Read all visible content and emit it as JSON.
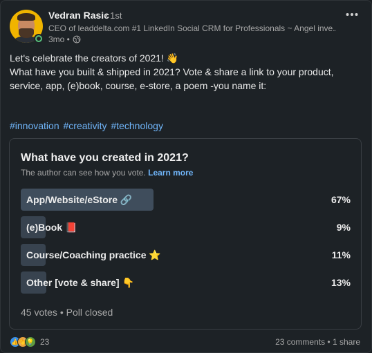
{
  "author": {
    "name": "Vedran Rasic",
    "degree": "• 1st",
    "headline": "CEO of leaddelta.com #1 LinkedIn Social CRM for Professionals ~ Angel inve...",
    "time": "3mo •"
  },
  "post": {
    "line1": "Let's celebrate the creators of 2021! 👋",
    "line2": "What have you built & shipped in 2021? Vote & share a link to your product, service, app, (e)book, course, e-store, a poem -you name it:",
    "hashtags": [
      "#innovation",
      "#creativity",
      "#technology"
    ]
  },
  "poll": {
    "question": "What have you created in 2021?",
    "visibility_note": "The author can see how you vote.",
    "learn_more": "Learn more",
    "options": [
      {
        "label": "App/Website/eStore 🔗",
        "percent": "67%",
        "share": 0.67,
        "selected": true
      },
      {
        "label": "(e)Book 📕",
        "percent": "9%",
        "share": 0.09,
        "selected": false
      },
      {
        "label": "Course/Coaching practice ⭐",
        "percent": "11%",
        "share": 0.11,
        "selected": false
      },
      {
        "label": "Other [vote & share] 👇",
        "percent": "13%",
        "share": 0.13,
        "selected": false
      }
    ],
    "footer": "45 votes • Poll closed"
  },
  "social": {
    "reaction_count": "23",
    "reaction_icons": [
      "like-icon",
      "celebrate-icon",
      "insightful-icon"
    ],
    "comments_shares": "23 comments • 1 share"
  },
  "colors": {
    "accent_link": "#70b5f9",
    "selected_bar": "#3f4d5c",
    "bar": "#38434f",
    "online": "#57c27c"
  }
}
